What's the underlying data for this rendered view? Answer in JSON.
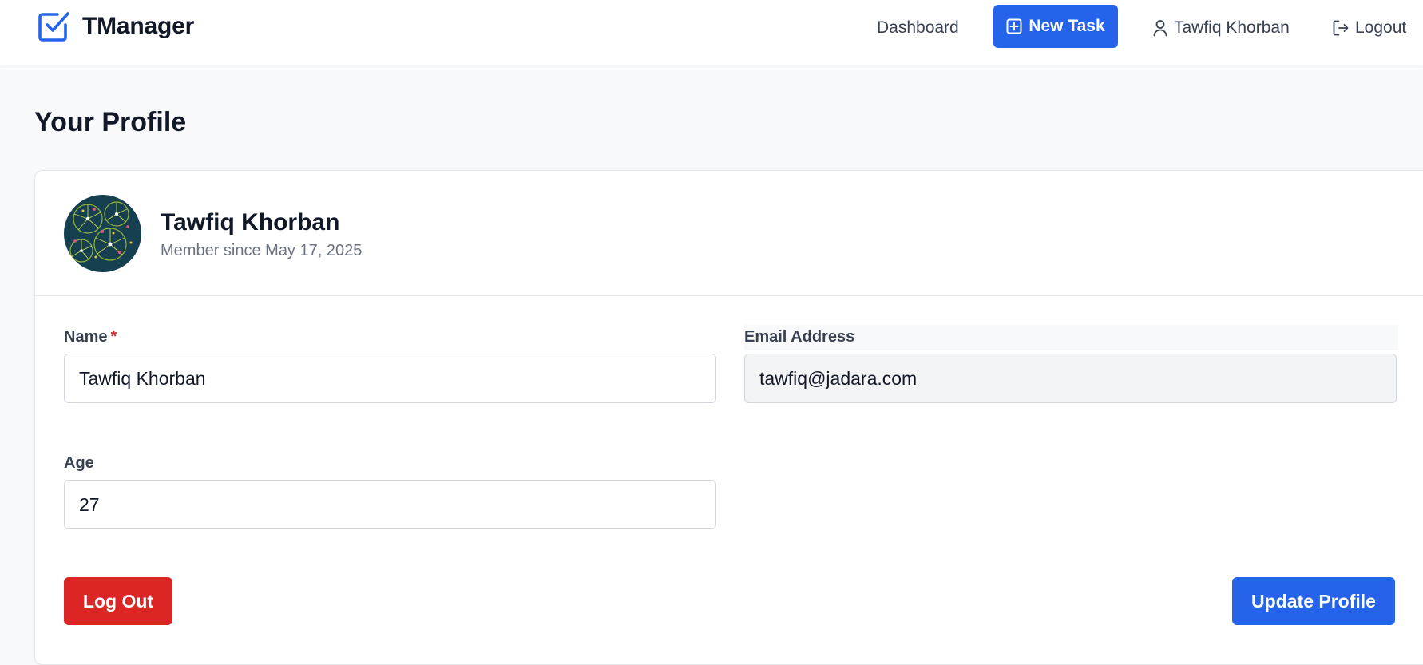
{
  "app": {
    "name": "TManager",
    "accent_color": "#2563eb",
    "danger_color": "#dc2626"
  },
  "nav": {
    "dashboard": "Dashboard",
    "new_task": "New Task",
    "user": "Tawfiq Khorban",
    "logout": "Logout"
  },
  "page": {
    "title": "Your Profile"
  },
  "profile": {
    "name": "Tawfiq Khorban",
    "member_since": "Member since May 17, 2025",
    "avatar_icon": "avatar-image"
  },
  "form": {
    "name_label": "Name",
    "name_required": "*",
    "name_value": "Tawfiq Khorban",
    "email_label": "Email Address",
    "email_value": "tawfiq@jadara.com",
    "age_label": "Age",
    "age_value": "27"
  },
  "actions": {
    "log_out": "Log Out",
    "update_profile": "Update Profile"
  }
}
